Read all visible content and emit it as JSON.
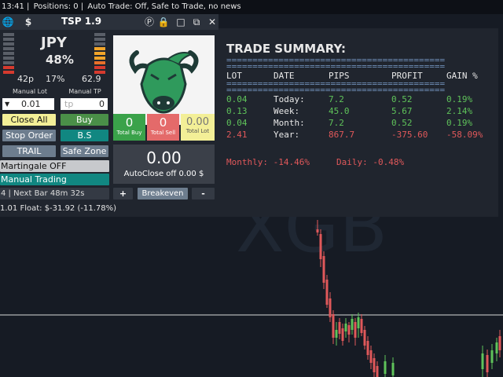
{
  "status": {
    "time": "13:41",
    "positions": "Positions: 0",
    "auto": "Auto Trade: Off, Safe to Trade, no news"
  },
  "panel": {
    "title": "TSP 1.9",
    "currency": "JPY",
    "percent": "48%",
    "left_pips": "42p",
    "mid_pct": "17%",
    "right_val": "62.9",
    "manual_lot_label": "Manual Lot",
    "manual_tp_label": "Manual TP",
    "lot_value": "0.01",
    "tp_placeholder": "tp",
    "tp_value": "0",
    "close_all": "Close All",
    "buy": "Buy",
    "stop_order": "Stop Order",
    "bs": "B.S",
    "trail": "TRAIL",
    "safe_zone": "Safe Zone",
    "martingale": "Martingale OFF",
    "manual_trading": "Manual Trading",
    "next_bar": "4 | Next Bar 48m 32s",
    "float": "1.01  Float: $-31.92 (-11.78%)",
    "total_buy_val": "0",
    "total_buy_lbl": "Total Buy",
    "total_sell_val": "0",
    "total_sell_lbl": "Total Sell",
    "total_lot_val": "0.00",
    "total_lot_lbl": "Total Lot",
    "profit_val": "0.00",
    "autoclose": "AutoClose off 0.00 $",
    "plus": "+",
    "breakeven": "Breakeven",
    "minus": "-"
  },
  "summary": {
    "title": "TRADE SUMMARY:",
    "rule": "==========================================",
    "headers": [
      "LOT",
      "DATE",
      "PIPS",
      "PROFIT",
      "GAIN %"
    ],
    "rows": [
      {
        "lot": "0.04",
        "date": "Today:",
        "pips": "7.2",
        "profit": "0.52",
        "gain": "0.19%",
        "color": "#5fc35a"
      },
      {
        "lot": "0.13",
        "date": "Week:",
        "pips": "45.0",
        "profit": "5.67",
        "gain": "2.14%",
        "color": "#5fc35a"
      },
      {
        "lot": "0.04",
        "date": "Month:",
        "pips": "7.2",
        "profit": "0.52",
        "gain": "0.19%",
        "color": "#5fc35a"
      },
      {
        "lot": "2.41",
        "date": "Year:",
        "pips": "867.7",
        "profit": "-375.60",
        "gain": "-58.09%",
        "color": "#e0585a"
      }
    ],
    "monthly": "Monthly: -14.46%",
    "daily": "Daily: -0.48%"
  },
  "colors": {
    "green": "#5fc35a",
    "red": "#e0585a",
    "rule": "#6f8fb8"
  }
}
